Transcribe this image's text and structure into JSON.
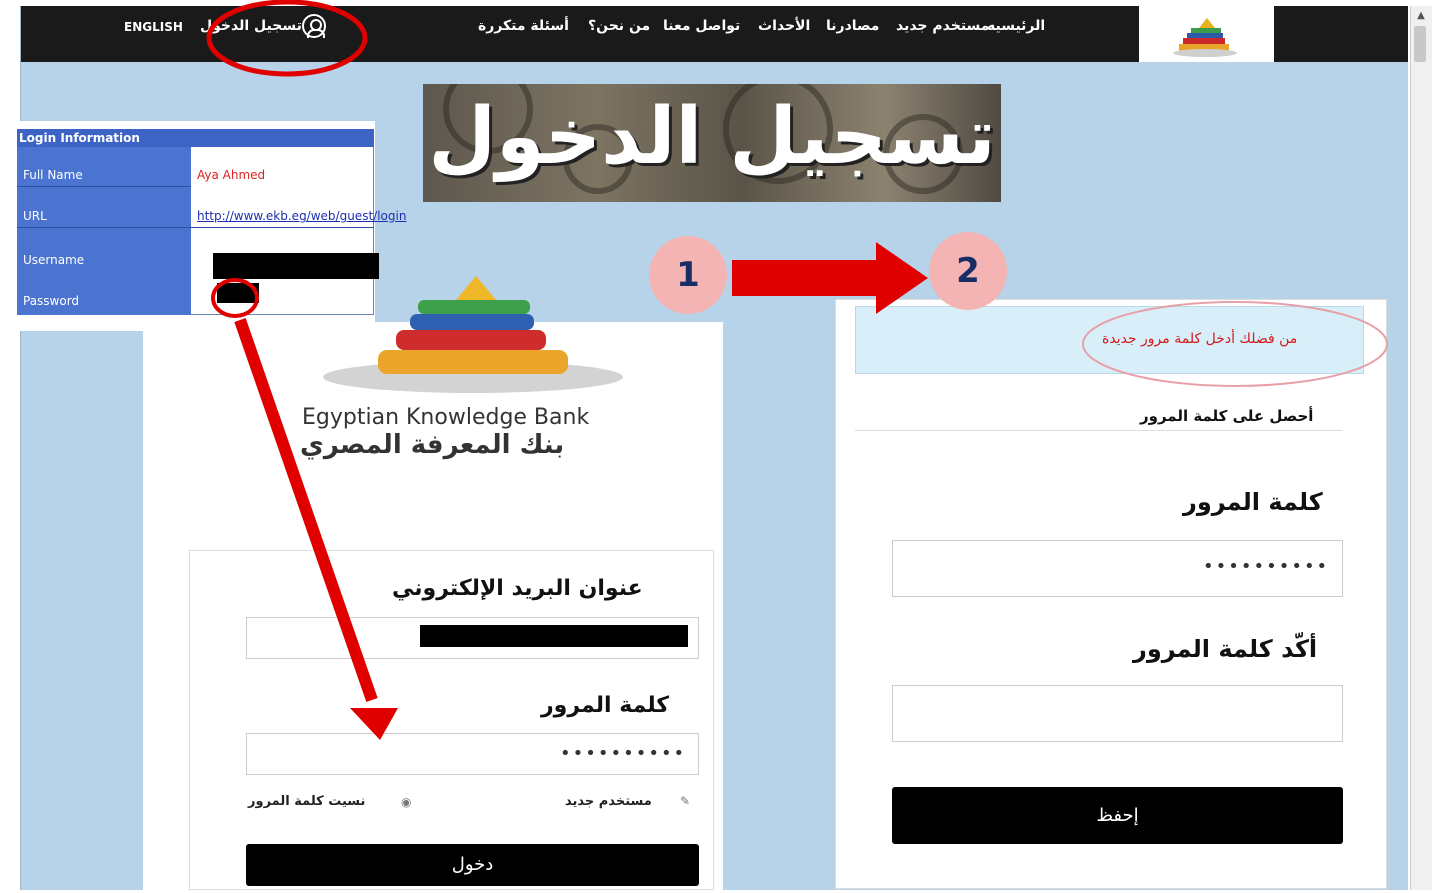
{
  "nav": {
    "home": "الرئيسيه",
    "new_user": "مستخدم جديد",
    "sources": "مصادرنا",
    "events": "الأحداث",
    "contact": "تواصل معنا",
    "about": "من نحن؟",
    "faq": "أسئلة متكررة",
    "login": "تسجيل الدخول",
    "language": "ENGLISH"
  },
  "banner": {
    "title": "تسجيل الدخول"
  },
  "info_table": {
    "header": "Login Information",
    "full_name_label": "Full Name",
    "full_name_value": "Aya Ahmed",
    "url_label": "URL",
    "url_value": "http://www.ekb.eg/web/guest/login",
    "username_label": "Username",
    "password_label": "Password"
  },
  "logo": {
    "english": "Egyptian Knowledge Bank",
    "arabic": "بنك المعرفة المصري"
  },
  "login_form": {
    "email_label": "عنوان البريد الإلكتروني",
    "password_label": "كلمة المرور",
    "password_value": "••••••••••",
    "forgot_password": "نسيت كلمة المرور",
    "new_user": "مستخدم جديد",
    "submit": "دخول"
  },
  "steps": {
    "step1": "1",
    "step2": "2"
  },
  "reset_form": {
    "alert": "من فضلك أدخل كلمة مرور جديدة",
    "get_password": "أحصل على كلمة المرور",
    "password_label": "كلمة المرور",
    "password_value": "••••••••••",
    "confirm_label": "أكّد كلمة المرور",
    "save": "إحفظ"
  },
  "colors": {
    "nav_bg": "#1a1a1a",
    "page_bg": "#b7d3ea",
    "annotation_red": "#e00000",
    "step_circle": "#f5b4b4"
  }
}
